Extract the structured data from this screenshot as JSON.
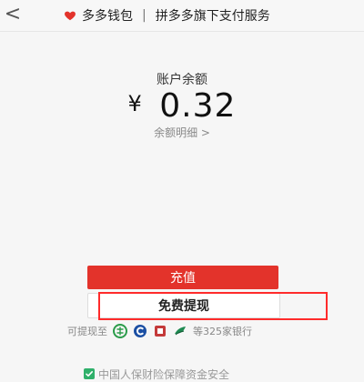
{
  "header": {
    "back_glyph": "<",
    "brand": "多多钱包",
    "subtitle": "拼多多旗下支付服务",
    "separator": "|"
  },
  "balance": {
    "label": "账户余额",
    "currency": "¥",
    "amount": "0.32",
    "details_link": "余额明细 >"
  },
  "actions": {
    "recharge_label": "充值",
    "withdraw_label": "免费提现"
  },
  "banks": {
    "prefix": "可提现至",
    "suffix": "等325家银行",
    "logos": [
      "bank-logo-1",
      "bank-logo-2",
      "bank-logo-3",
      "bank-logo-4"
    ]
  },
  "footer": {
    "text": "中国人保财险保障资金安全"
  },
  "colors": {
    "primary_red": "#e3332b",
    "highlight_red": "#ff2b2b",
    "secure_green": "#2fb06a"
  }
}
